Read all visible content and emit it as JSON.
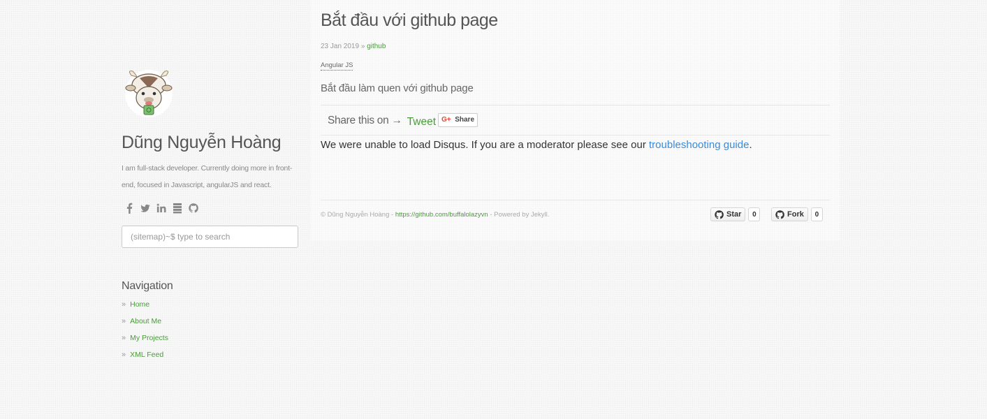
{
  "sidebar": {
    "author_name": "Dũng Nguyễn Hoàng",
    "bio": "I am full-stack developer. Currently doing more in front-end, focused in Javascript, angularJS and react.",
    "social_icons": [
      "facebook-icon",
      "twitter-icon",
      "linkedin-icon",
      "stack-icon",
      "github-icon"
    ],
    "search": {
      "placeholder": "(sitemap)~$ type to search",
      "value": ""
    },
    "nav_heading": "Navigation",
    "nav_bullet": "»",
    "nav_items": [
      {
        "label": "Home"
      },
      {
        "label": "About Me"
      },
      {
        "label": "My Projects"
      },
      {
        "label": "XML Feed"
      }
    ]
  },
  "post": {
    "title": "Bắt đầu với github page",
    "date": "23 Jan 2019",
    "meta_separator": "»",
    "category": "github",
    "tag": "Angular JS",
    "excerpt": "Bắt đầu làm quen với github page"
  },
  "share": {
    "label": "Share this on →",
    "tweet": "Tweet",
    "gplus_icon": "G+",
    "gplus_label": "Share"
  },
  "disqus": {
    "message": "We were unable to load Disqus. If you are a moderator please see our",
    "link": "troubleshooting guide",
    "period": "."
  },
  "footer": {
    "copyright": "© Dũng Nguyễn Hoàng -",
    "link": "https://github.com/buffalolazyvn",
    "powered": "- Powered by Jekyll."
  },
  "github": {
    "star_label": "Star",
    "star_count": "0",
    "fork_label": "Fork",
    "fork_count": "0"
  },
  "colors": {
    "link_green": "#4a9a3c",
    "link_blue": "#3b8ad8",
    "text": "#666666"
  }
}
